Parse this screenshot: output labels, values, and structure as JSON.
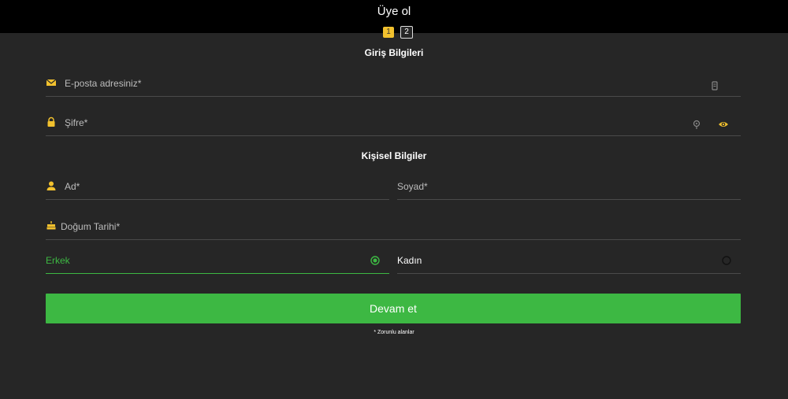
{
  "header": {
    "title": "Üye ol"
  },
  "steps": [
    "1",
    "2"
  ],
  "sections": {
    "login": "Giriş Bilgileri",
    "personal": "Kişisel Bilgiler"
  },
  "fields": {
    "email": "E-posta adresiniz*",
    "password": "Şifre*",
    "first_name": "Ad*",
    "last_name": "Soyad*",
    "birth_date": "Doğum Tarihi*"
  },
  "gender": {
    "options": [
      {
        "label": "Erkek",
        "selected": true
      },
      {
        "label": "Kadın",
        "selected": false
      }
    ]
  },
  "button": {
    "continue": "Devam et"
  },
  "note": "* Zorunlu alanlar",
  "colors": {
    "accent": "#3db843",
    "icon": "#f2c12e",
    "background": "#262626",
    "header": "#000000"
  },
  "icons": {
    "email": "envelope-icon",
    "password": "lock-icon",
    "first_name": "user-icon",
    "birth_date": "cake-icon",
    "email_right": "document-icon",
    "password_right": "key-icon",
    "password_toggle": "eye-icon"
  }
}
